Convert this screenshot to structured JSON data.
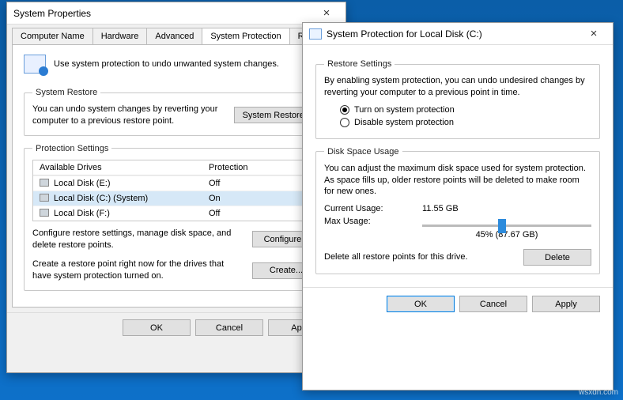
{
  "win1": {
    "title": "System Properties",
    "tabs": [
      "Computer Name",
      "Hardware",
      "Advanced",
      "System Protection",
      "Remote"
    ],
    "active_tab": 3,
    "intro": "Use system protection to undo unwanted system changes.",
    "restore": {
      "legend": "System Restore",
      "text": "You can undo system changes by reverting your computer to a previous restore point.",
      "button": "System Restore..."
    },
    "protection": {
      "legend": "Protection Settings",
      "head": {
        "drives": "Available Drives",
        "protection": "Protection"
      },
      "rows": [
        {
          "name": "Local Disk (E:)",
          "status": "Off",
          "selected": false
        },
        {
          "name": "Local Disk (C:) (System)",
          "status": "On",
          "selected": true
        },
        {
          "name": "Local Disk (F:)",
          "status": "Off",
          "selected": false
        }
      ],
      "configure_text": "Configure restore settings, manage disk space, and delete restore points.",
      "configure_btn": "Configure...",
      "create_text": "Create a restore point right now for the drives that have system protection turned on.",
      "create_btn": "Create..."
    },
    "footer": {
      "ok": "OK",
      "cancel": "Cancel",
      "apply": "Apply"
    }
  },
  "win2": {
    "title": "System Protection for Local Disk (C:)",
    "restore": {
      "legend": "Restore Settings",
      "desc": "By enabling system protection, you can undo undesired changes by reverting your computer to a previous point in time.",
      "opt_on": "Turn on system protection",
      "opt_off": "Disable system protection",
      "selected": "on"
    },
    "usage": {
      "legend": "Disk Space Usage",
      "desc": "You can adjust the maximum disk space used for system protection. As space fills up, older restore points will be deleted to make room for new ones.",
      "current_label": "Current Usage:",
      "current_value": "11.55 GB",
      "max_label": "Max Usage:",
      "slider_percent": 45,
      "slider_label": "45% (87.67 GB)",
      "delete_text": "Delete all restore points for this drive.",
      "delete_btn": "Delete"
    },
    "footer": {
      "ok": "OK",
      "cancel": "Cancel",
      "apply": "Apply"
    }
  },
  "watermark": "wsxdn.com"
}
